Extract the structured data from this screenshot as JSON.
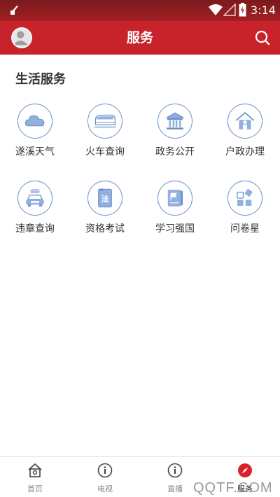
{
  "status_bar": {
    "time": "3:14"
  },
  "header": {
    "title": "服务"
  },
  "section": {
    "title": "生活服务"
  },
  "services": [
    {
      "label": "遂溪天气",
      "icon": "cloud-icon"
    },
    {
      "label": "火车查询",
      "icon": "train-icon"
    },
    {
      "label": "政务公开",
      "icon": "government-building-icon"
    },
    {
      "label": "户政办理",
      "icon": "house-person-icon"
    },
    {
      "label": "违章查询",
      "icon": "car-icon"
    },
    {
      "label": "资格考试",
      "icon": "law-book-icon"
    },
    {
      "label": "学习强国",
      "icon": "flag-book-icon"
    },
    {
      "label": "问卷星",
      "icon": "questionnaire-icon"
    }
  ],
  "nav": [
    {
      "label": "首页",
      "icon": "home-icon"
    },
    {
      "label": "电视",
      "icon": "info-circle-icon"
    },
    {
      "label": "直播",
      "icon": "info-circle-icon"
    },
    {
      "label": "服务",
      "icon": "compass-icon",
      "active": true
    }
  ],
  "watermark": "QQTF.COM",
  "colors": {
    "brand_red": "#c8232b",
    "icon_blue": "#6a8fc7"
  }
}
